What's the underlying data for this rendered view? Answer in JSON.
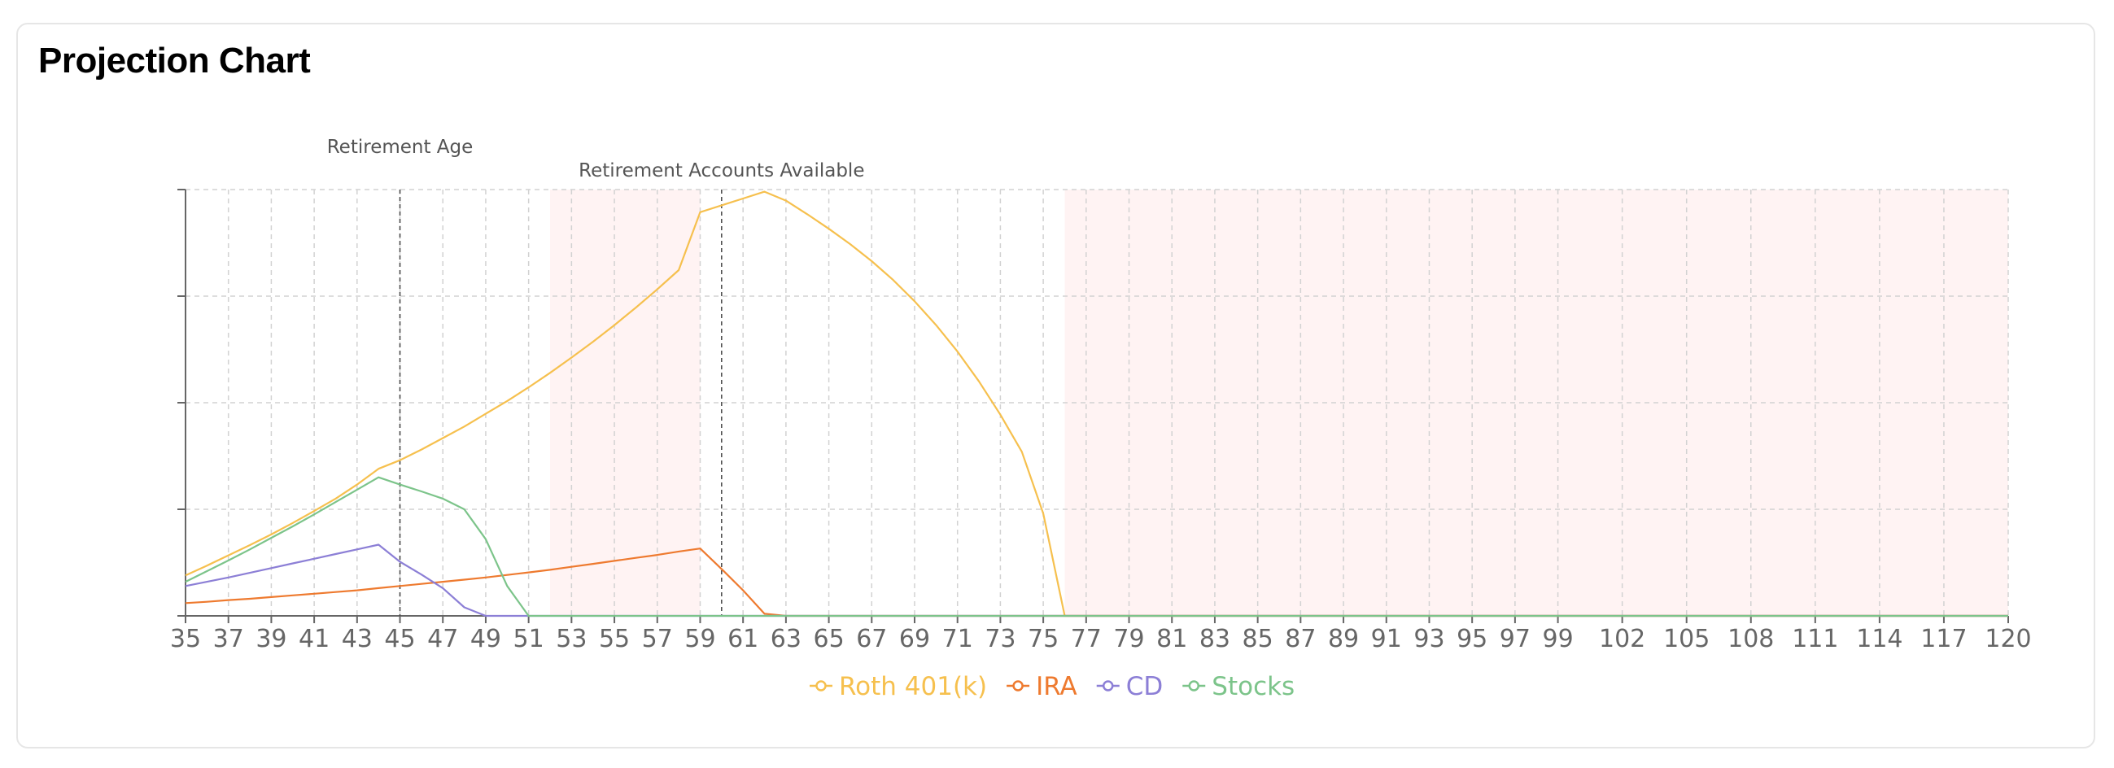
{
  "card": {
    "title": "Projection Chart"
  },
  "chart_data": {
    "type": "line",
    "title": "",
    "xlabel": "",
    "ylabel": "",
    "x": [
      35,
      36,
      37,
      38,
      39,
      40,
      41,
      42,
      43,
      44,
      45,
      46,
      47,
      48,
      49,
      50,
      51,
      52,
      53,
      54,
      55,
      56,
      57,
      58,
      59,
      60,
      61,
      62,
      63,
      64,
      65,
      66,
      67,
      68,
      69,
      70,
      71,
      72,
      73,
      74,
      75,
      76,
      77,
      78,
      79,
      80,
      81,
      82,
      83,
      84,
      85,
      86,
      87,
      88,
      89,
      90,
      91,
      92,
      93,
      94,
      95,
      96,
      97,
      98,
      99,
      100,
      101,
      102,
      103,
      104,
      105,
      106,
      107,
      108,
      109,
      110,
      111,
      112,
      113,
      114,
      115,
      116,
      117,
      118,
      119,
      120
    ],
    "tick_labels": [
      "35",
      "37",
      "39",
      "41",
      "43",
      "45",
      "47",
      "49",
      "51",
      "53",
      "55",
      "57",
      "59",
      "61",
      "63",
      "65",
      "67",
      "69",
      "71",
      "73",
      "75",
      "77",
      "79",
      "81",
      "83",
      "85",
      "87",
      "89",
      "91",
      "93",
      "95",
      "97",
      "99",
      "102",
      "105",
      "108",
      "111",
      "114",
      "117",
      "120"
    ],
    "ylim": [
      0,
      100
    ],
    "y_tick_values": [
      0,
      25,
      50,
      75,
      100
    ],
    "y_tick_labels_visible": false,
    "grid": true,
    "legend_position": "bottom",
    "shaded_ranges": [
      {
        "from": 52,
        "to": 59,
        "color": "#fff3f3"
      },
      {
        "from": 76,
        "to": 120,
        "color": "#fff3f3"
      }
    ],
    "annotations": [
      {
        "x": 45,
        "label": "Retirement Age"
      },
      {
        "x": 60,
        "label": "Retirement Accounts Available"
      }
    ],
    "series": [
      {
        "name": "Roth 401(k)",
        "color": "#f6c04e",
        "values": [
          9.5,
          11.8,
          14.2,
          16.6,
          19.1,
          21.8,
          24.6,
          27.5,
          30.8,
          34.5,
          36.5,
          39.0,
          41.7,
          44.4,
          47.4,
          50.4,
          53.6,
          57.0,
          60.6,
          64.3,
          68.2,
          72.3,
          76.6,
          81.1,
          94.7,
          96.3,
          97.9,
          99.5,
          97.4,
          94.2,
          90.8,
          87.2,
          83.2,
          78.8,
          73.8,
          68.2,
          62.0,
          55.0,
          47.2,
          38.5,
          24.0,
          0,
          0,
          0,
          0,
          0,
          0,
          0,
          0,
          0,
          0,
          0,
          0,
          0,
          0,
          0,
          0,
          0,
          0,
          0,
          0,
          0,
          0,
          0,
          0,
          0,
          0,
          0,
          0,
          0,
          0,
          0,
          0,
          0,
          0,
          0,
          0,
          0,
          0,
          0,
          0,
          0,
          0,
          0,
          0,
          0
        ]
      },
      {
        "name": "IRA",
        "color": "#ee7a2f",
        "values": [
          3.0,
          3.3,
          3.7,
          4.0,
          4.4,
          4.8,
          5.2,
          5.6,
          6.0,
          6.5,
          7.0,
          7.5,
          8.0,
          8.5,
          9.0,
          9.6,
          10.2,
          10.8,
          11.5,
          12.2,
          12.9,
          13.6,
          14.3,
          15.1,
          15.8,
          11.0,
          6.0,
          0.5,
          0,
          0,
          0,
          0,
          0,
          0,
          0,
          0,
          0,
          0,
          0,
          0,
          0,
          0,
          0,
          0,
          0,
          0,
          0,
          0,
          0,
          0,
          0,
          0,
          0,
          0,
          0,
          0,
          0,
          0,
          0,
          0,
          0,
          0,
          0,
          0,
          0,
          0,
          0,
          0,
          0,
          0,
          0,
          0,
          0,
          0,
          0,
          0,
          0,
          0,
          0,
          0,
          0,
          0,
          0,
          0,
          0,
          0
        ]
      },
      {
        "name": "CD",
        "color": "#8c7fd6",
        "values": [
          7.0,
          8.0,
          9.0,
          10.1,
          11.2,
          12.3,
          13.4,
          14.5,
          15.6,
          16.7,
          12.7,
          9.7,
          6.5,
          2.0,
          0,
          0,
          0,
          0,
          0,
          0,
          0,
          0,
          0,
          0,
          0,
          0,
          0,
          0,
          0,
          0,
          0,
          0,
          0,
          0,
          0,
          0,
          0,
          0,
          0,
          0,
          0,
          0,
          0,
          0,
          0,
          0,
          0,
          0,
          0,
          0,
          0,
          0,
          0,
          0,
          0,
          0,
          0,
          0,
          0,
          0,
          0,
          0,
          0,
          0,
          0,
          0,
          0,
          0,
          0,
          0,
          0,
          0,
          0,
          0,
          0,
          0,
          0,
          0,
          0,
          0,
          0,
          0,
          0,
          0,
          0,
          0
        ]
      },
      {
        "name": "Stocks",
        "color": "#7cc48a",
        "values": [
          8.0,
          10.5,
          13.0,
          15.6,
          18.3,
          21.0,
          23.8,
          26.7,
          29.6,
          32.5,
          30.8,
          29.2,
          27.5,
          25.0,
          18.0,
          7.0,
          0,
          0,
          0,
          0,
          0,
          0,
          0,
          0,
          0,
          0,
          0,
          0,
          0,
          0,
          0,
          0,
          0,
          0,
          0,
          0,
          0,
          0,
          0,
          0,
          0,
          0,
          0,
          0,
          0,
          0,
          0,
          0,
          0,
          0,
          0,
          0,
          0,
          0,
          0,
          0,
          0,
          0,
          0,
          0,
          0,
          0,
          0,
          0,
          0,
          0,
          0,
          0,
          0,
          0,
          0,
          0,
          0,
          0,
          0,
          0,
          0,
          0,
          0,
          0,
          0,
          0,
          0,
          0,
          0,
          0
        ]
      }
    ]
  }
}
